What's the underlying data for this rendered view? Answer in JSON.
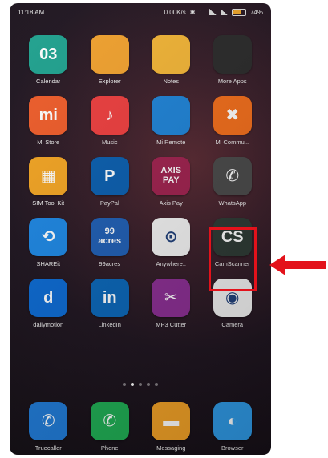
{
  "status_bar": {
    "time": "11:18 AM",
    "network": "0.00K/s",
    "battery": "74%",
    "battery_level": 0.74
  },
  "apps": [
    {
      "label": "Calendar",
      "icon": "calendar-icon",
      "color": "#1fa28f",
      "glyph": "03"
    },
    {
      "label": "Explorer",
      "icon": "folder-icon",
      "color": "#f3a32f",
      "glyph": ""
    },
    {
      "label": "Notes",
      "icon": "notes-icon",
      "color": "#f4b637",
      "glyph": ""
    },
    {
      "label": "More Apps",
      "icon": "folder-apps-icon",
      "color": "#2b2b2b",
      "glyph": ""
    },
    {
      "label": "Mi Store",
      "icon": "mi-store-icon",
      "color": "#f05d2a",
      "glyph": "mi"
    },
    {
      "label": "Music",
      "icon": "music-icon",
      "color": "#ef3f3f",
      "glyph": "♪"
    },
    {
      "label": "Mi Remote",
      "icon": "mi-remote-icon",
      "color": "#1f84d8",
      "glyph": ""
    },
    {
      "label": "Mi Commu...",
      "icon": "mi-community-icon",
      "color": "#f36e1b",
      "glyph": "✖"
    },
    {
      "label": "SIM Tool Kit",
      "icon": "sim-toolkit-icon",
      "color": "#f5a623",
      "glyph": "▦"
    },
    {
      "label": "PayPal",
      "icon": "paypal-icon",
      "color": "#0a5fb0",
      "glyph": "P"
    },
    {
      "label": "Axis Pay",
      "icon": "axis-pay-icon",
      "color": "#a0224f",
      "glyph": "AXIS\nPAY"
    },
    {
      "label": "WhatsApp",
      "icon": "whatsapp-icon",
      "color": "#4a4a4a",
      "glyph": "✆"
    },
    {
      "label": "SHAREit",
      "icon": "shareit-icon",
      "color": "#1d88e5",
      "glyph": "⟲"
    },
    {
      "label": "99acres",
      "icon": "99acres-icon",
      "color": "#1f5fb5",
      "glyph": "99\nacres"
    },
    {
      "label": "Anywhere..",
      "icon": "sbi-anywhere-icon",
      "color": "#f4f4f4",
      "glyph": "⊙"
    },
    {
      "label": "CamScanner",
      "icon": "camscanner-icon",
      "color": "#2d3a34",
      "glyph": "CS"
    },
    {
      "label": "dailymotion",
      "icon": "dailymotion-icon",
      "color": "#0b6ad3",
      "glyph": "d"
    },
    {
      "label": "LinkedIn",
      "icon": "linkedin-icon",
      "color": "#0a66b8",
      "glyph": "in"
    },
    {
      "label": "MP3 Cutter",
      "icon": "mp3-cutter-icon",
      "color": "#8b2e93",
      "glyph": "✂"
    },
    {
      "label": "Camera",
      "icon": "camera-icon",
      "color": "#f2f2f2",
      "glyph": "◉"
    }
  ],
  "dock": [
    {
      "label": "Truecaller",
      "icon": "truecaller-icon",
      "color": "#1f7ad6",
      "glyph": "✆"
    },
    {
      "label": "Phone",
      "icon": "phone-icon",
      "color": "#1fae54",
      "glyph": "✆"
    },
    {
      "label": "Messaging",
      "icon": "messaging-icon",
      "color": "#f3a226",
      "glyph": "▬"
    },
    {
      "label": "Browser",
      "icon": "browser-icon",
      "color": "#2f9be8",
      "glyph": "◐"
    }
  ],
  "page_indicator": {
    "count": 5,
    "active": 1
  },
  "annotation": {
    "highlight_color": "#e3121b",
    "arrow_color": "#e3121b"
  }
}
